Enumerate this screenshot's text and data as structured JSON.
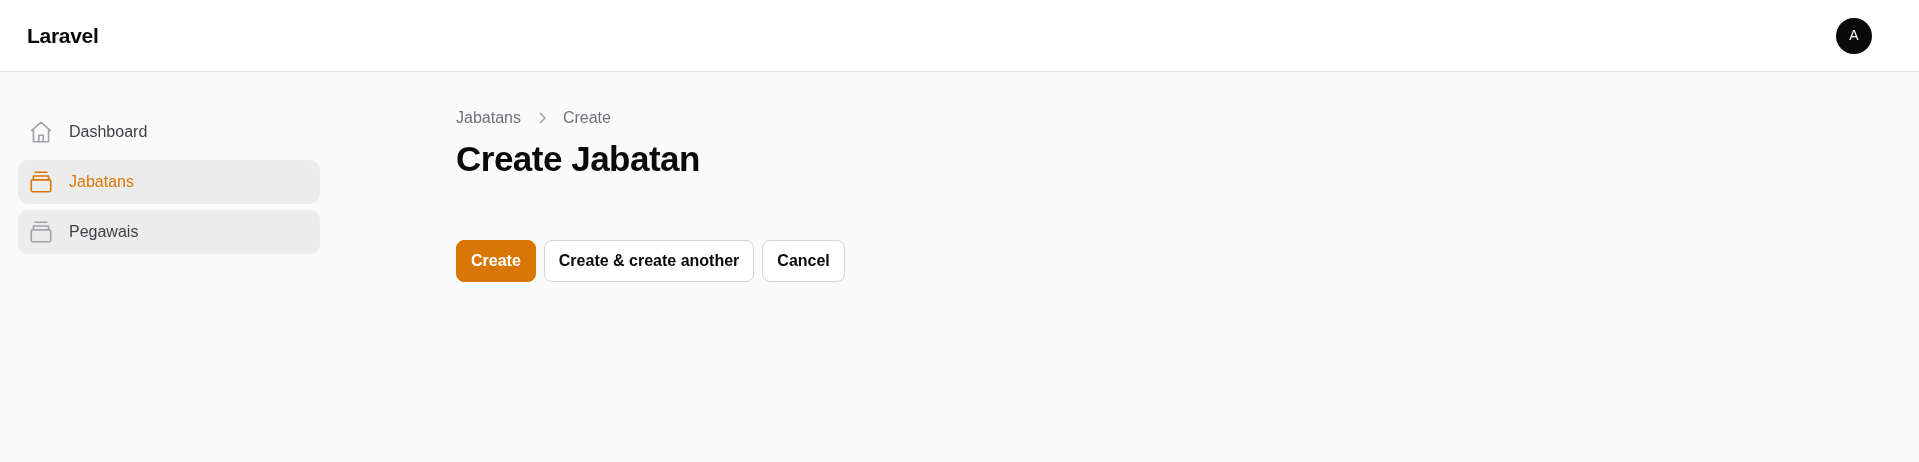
{
  "header": {
    "brand": "Laravel",
    "avatar": "A"
  },
  "sidebar": {
    "items": [
      {
        "label": "Dashboard",
        "kind": "home",
        "selected": false,
        "hovered": false
      },
      {
        "label": "Jabatans",
        "kind": "stack",
        "selected": true,
        "hovered": true
      },
      {
        "label": "Pegawais",
        "kind": "stack",
        "selected": false,
        "hovered": true
      }
    ]
  },
  "breadcrumbs": [
    "Jabatans",
    "Create"
  ],
  "title": "Create Jabatan",
  "buttons": [
    {
      "label": "Create",
      "kind": "primary"
    },
    {
      "label": "Create & create another",
      "kind": "secondary"
    },
    {
      "label": "Cancel",
      "kind": "secondary"
    }
  ]
}
